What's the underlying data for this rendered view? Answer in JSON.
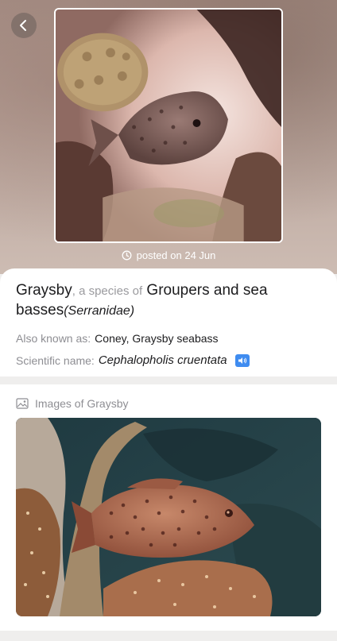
{
  "header": {
    "back_icon": "chevron-left-icon",
    "posted_label": "posted on 24 Jun"
  },
  "species": {
    "common_name": "Graysby",
    "species_of_text": ", a species of",
    "group_name": "Groupers and sea basses",
    "family": "(Serranidae)",
    "aka_label": "Also known as:",
    "aka_value": "Coney, Graysby seabass",
    "sci_label": "Scientific name:",
    "sci_value": "Cephalopholis cruentata"
  },
  "images_section": {
    "icon": "image-icon",
    "title": "Images of Graysby"
  },
  "colors": {
    "accent": "#3f8cf0",
    "muted_text": "#8e8e93"
  }
}
